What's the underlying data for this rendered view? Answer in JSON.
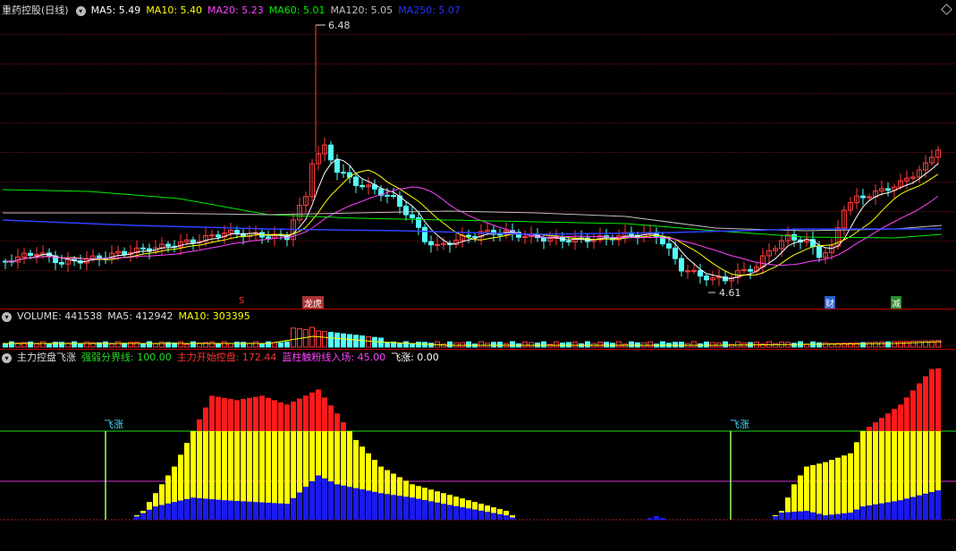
{
  "main": {
    "title": "重药控股(日线)",
    "ma": [
      {
        "label": "MA5: 5.49",
        "color": "#ffffff"
      },
      {
        "label": "MA10: 5.40",
        "color": "#ffff00"
      },
      {
        "label": "MA20: 5.23",
        "color": "#ff44ff"
      },
      {
        "label": "MA60: 5.01",
        "color": "#00ee00"
      },
      {
        "label": "MA120: 5.05",
        "color": "#c0c0c0"
      },
      {
        "label": "MA250: 5.07",
        "color": "#2233ff"
      }
    ],
    "high_label": "6.48",
    "low_label": "4.61",
    "event_markers": [
      {
        "text": "S",
        "color": "#ff3333"
      },
      {
        "text": "龙虎",
        "color": "#ff5555"
      },
      {
        "text": "财",
        "color": "#4488ff"
      },
      {
        "text": "减",
        "color": "#22cc22"
      }
    ]
  },
  "volume": {
    "title": "VOLUME: 441538",
    "ma5": "MA5: 412942",
    "ma10": "MA10: 303395"
  },
  "indicator": {
    "title": "主力控盘飞涨",
    "lines": [
      {
        "label": "强弱分界线: 100.00",
        "color": "#22dd22"
      },
      {
        "label": "主力开始控盘: 172.44",
        "color": "#ff3333"
      },
      {
        "label": "蓝柱触粉线入场: 45.00",
        "color": "#ff44ff"
      },
      {
        "label": "飞涨: 0.00",
        "color": "#ffffff"
      }
    ],
    "signal_label": "飞涨"
  },
  "colors": {
    "up": "#ff3c3c",
    "down": "#54ffff",
    "separator": "#b00000"
  }
}
